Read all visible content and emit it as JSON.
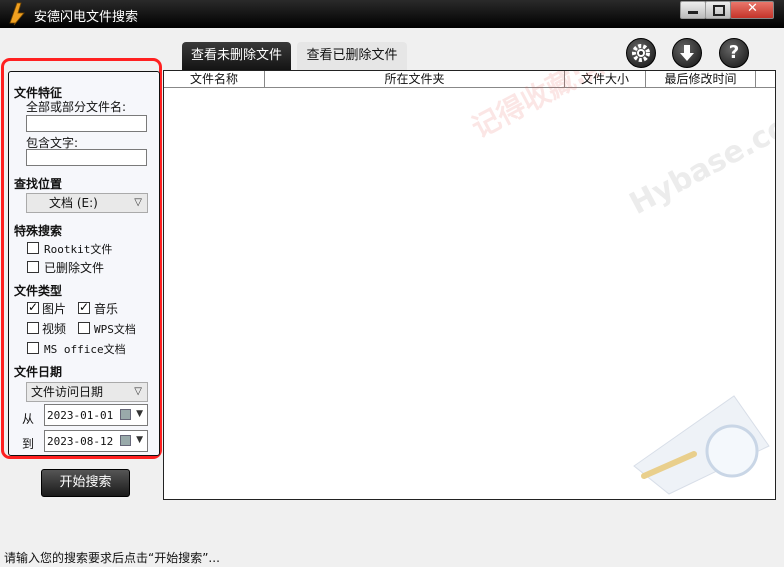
{
  "app": {
    "title": "安德闪电文件搜索"
  },
  "window_controls": {
    "minimize_icon": "minimize-icon",
    "maximize_icon": "maximize-icon",
    "close_icon": "close-icon"
  },
  "tabs": [
    {
      "label": "查看未删除文件",
      "active": true
    },
    {
      "label": "查看已删除文件",
      "active": false
    }
  ],
  "toolbar": {
    "icons": [
      "gear-icon",
      "download-icon",
      "help-icon"
    ]
  },
  "panel": {
    "file_feature": {
      "title": "文件特征",
      "name_label": "全部或部分文件名:",
      "name_value": "",
      "content_label": "包含文字:",
      "content_value": ""
    },
    "location": {
      "title": "查找位置",
      "selected": "文档 (E:)"
    },
    "special": {
      "title": "特殊搜索",
      "options": [
        {
          "label": "Rootkit文件",
          "checked": false
        },
        {
          "label": "已删除文件",
          "checked": false
        }
      ]
    },
    "file_type": {
      "title": "文件类型",
      "options": [
        {
          "label": "图片",
          "checked": true
        },
        {
          "label": "音乐",
          "checked": true
        },
        {
          "label": "视频",
          "checked": false
        },
        {
          "label": "WPS文档",
          "checked": false
        },
        {
          "label": "MS office文档",
          "checked": false
        }
      ]
    },
    "file_date": {
      "title": "文件日期",
      "selected": "文件访问日期",
      "from_label": "从",
      "from_value": "2023-01-01",
      "to_label": "到",
      "to_value": "2023-08-12"
    }
  },
  "search_button": {
    "label": "开始搜索"
  },
  "results": {
    "columns": [
      "文件名称",
      "所在文件夹",
      "文件大小",
      "最后修改时间"
    ],
    "rows": []
  },
  "watermark": {
    "text1": "记得收藏:黑域基地",
    "text2": "Hybase.com"
  },
  "status": {
    "text": "请输入您的搜索要求后点击“开始搜索”..."
  },
  "colors": {
    "highlight_frame": "#ff2020",
    "titlebar": "#111111",
    "accent": "#000000"
  }
}
